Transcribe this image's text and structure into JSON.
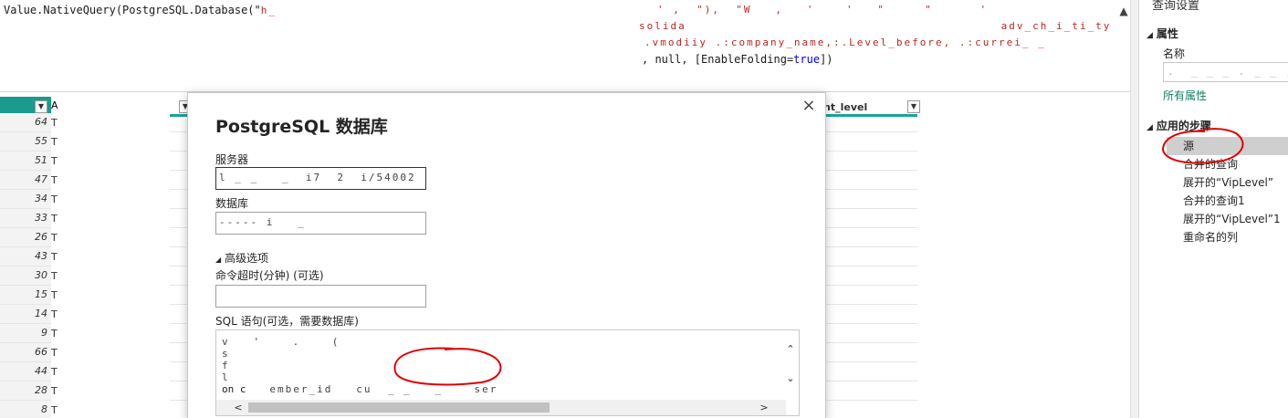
{
  "formula": {
    "line1_prefix": "Value.NativeQuery(PostgreSQL.Database(\"",
    "line2_suffix_before": ", null, [EnableFolding=",
    "line2_true": "true",
    "line2_suffix_after": "])",
    "collapse_icon": "chevron-up-icon"
  },
  "grid": {
    "row_numbers": [
      "64",
      "55",
      "51",
      "47",
      "34",
      "33",
      "26",
      "43",
      "30",
      "15",
      "14",
      "9",
      "66",
      "44",
      "28",
      "8"
    ],
    "row_cell_text": "T",
    "column_header_current_level": "nt_level",
    "partial_col_a": "A"
  },
  "dialog": {
    "title": "PostgreSQL 数据库",
    "close_icon": "close-icon",
    "server_label": "服务器",
    "database_label": "数据库",
    "advanced_label": "高级选项",
    "timeout_label": "命令超时(分钟) (可选)",
    "timeout_value": "",
    "sql_label": "SQL 语句(可选，需要数据库)",
    "sql_last_line": "on c"
  },
  "query_settings": {
    "pane_title": "查询设置",
    "properties_heading": "属性",
    "name_label": "名称",
    "all_properties_link": "所有属性",
    "applied_steps_heading": "应用的步骤",
    "steps": [
      {
        "label": "源",
        "selected": true
      },
      {
        "label": "合并的查询",
        "selected": false
      },
      {
        "label": "展开的“VipLevel”",
        "selected": false
      },
      {
        "label": "合并的查询1",
        "selected": false
      },
      {
        "label": "展开的“VipLevel”1",
        "selected": false
      },
      {
        "label": "重命名的列",
        "selected": false
      }
    ]
  },
  "colors": {
    "accent_teal": "#1ca39a",
    "link_green": "#0f7f64",
    "annotation_red": "#e00000"
  }
}
